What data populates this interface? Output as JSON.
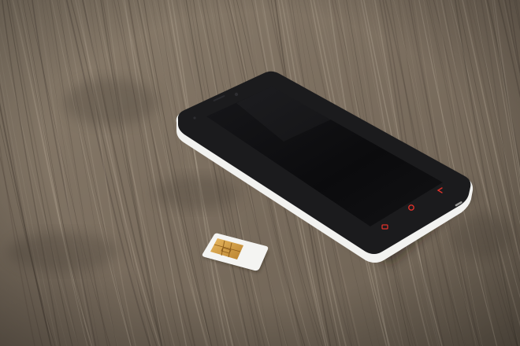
{
  "scene": {
    "description_free": true,
    "surface": {
      "material_icon": "wood-grain",
      "base_color": "#7a6d5e",
      "light_color": "#a89b8a",
      "dark_color": "#4e443a",
      "vignette_color": "#2e2720"
    },
    "phone": {
      "body_color": "#1b1b1d",
      "bezel_edge_color": "#f2f2f0",
      "screen_color": "#0d0d0f",
      "button_color": "#e0322b",
      "nav_buttons": [
        "menu-icon",
        "home-icon",
        "back-icon"
      ]
    },
    "sim_card": {
      "card_color": "#f4f4f2",
      "chip_color": "#d6a14a",
      "chip_line_color": "#8a5a1a"
    }
  }
}
